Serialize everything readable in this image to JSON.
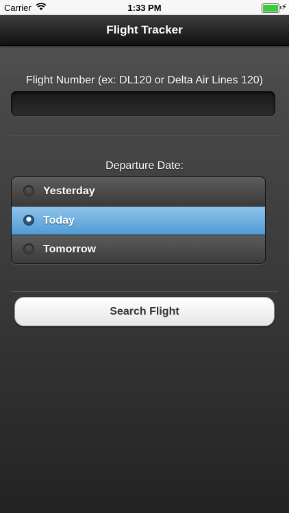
{
  "status_bar": {
    "carrier": "Carrier",
    "time": "1:33 PM",
    "battery_level": 1.0
  },
  "nav": {
    "title": "Flight Tracker"
  },
  "form": {
    "flight_label": "Flight Number (ex: DL120 or Delta Air Lines 120)",
    "flight_value": "",
    "date_label": "Departure Date:",
    "date_options": [
      {
        "label": "Yesterday",
        "selected": false
      },
      {
        "label": "Today",
        "selected": true
      },
      {
        "label": "Tomorrow",
        "selected": false
      }
    ],
    "search_label": "Search Flight"
  },
  "colors": {
    "selected_row": "#5fa4dc",
    "battery": "#3cc93c"
  }
}
